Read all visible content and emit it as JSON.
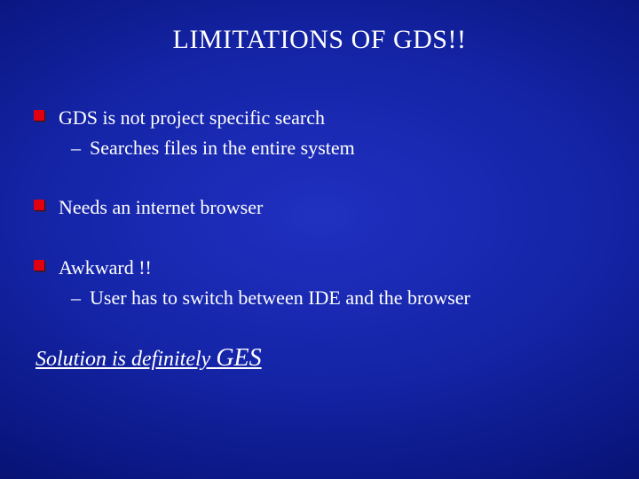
{
  "title": "LIMITATIONS OF GDS!!",
  "bullets": [
    {
      "text": "GDS is not project specific search",
      "subs": [
        "Searches files in the entire system"
      ]
    },
    {
      "text": "Needs an internet browser",
      "subs": []
    },
    {
      "text": "Awkward !!",
      "subs": [
        "User has to switch between IDE and the browser"
      ]
    }
  ],
  "solution_prefix": "Solution is definitely ",
  "solution_emph": "GES"
}
